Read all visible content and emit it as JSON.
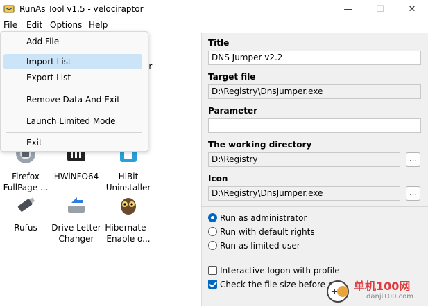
{
  "window": {
    "title": "RunAs Tool v1.5 - velociraptor",
    "minimize": "—",
    "maximize": "☐",
    "close": "✕"
  },
  "menubar": {
    "items": [
      "File",
      "Edit",
      "Options",
      "Help"
    ]
  },
  "file_menu": {
    "items": [
      "Add File",
      "Import List",
      "Export List",
      "Remove Data And Exit",
      "Launch Limited Mode",
      "Exit"
    ],
    "highlighted": "Import List"
  },
  "apps": {
    "partial_right_text": "er",
    "tiles": [
      {
        "label": "Firefox FullPage ...",
        "icon": "firefox-screenshot-icon"
      },
      {
        "label": "HWiNFO64",
        "icon": "hwinfo-icon"
      },
      {
        "label": "HiBit Uninstaller",
        "icon": "hibit-uninstaller-icon"
      },
      {
        "label": "Rufus",
        "icon": "usb-drive-icon"
      },
      {
        "label": "Drive Letter Changer",
        "icon": "drive-arrows-icon"
      },
      {
        "label": "Hibernate - Enable o...",
        "icon": "owl-icon"
      }
    ]
  },
  "details": {
    "title_label": "Title",
    "title_value": "DNS Jumper v2.2",
    "target_label": "Target file",
    "target_value": "D:\\Registry\\DnsJumper.exe",
    "param_label": "Parameter",
    "param_value": "",
    "workdir_label": "The working directory",
    "workdir_value": "D:\\Registry",
    "icon_label": "Icon",
    "icon_value": "D:\\Registry\\DnsJumper.exe",
    "browse_label": "..."
  },
  "run_mode": {
    "options": [
      "Run as administrator",
      "Run with default rights",
      "Run as limited user"
    ],
    "selected": "Run as administrator"
  },
  "checks": {
    "interactive": "Interactive logon with profile",
    "interactive_checked": false,
    "filesize": "Check the file size before run",
    "filesize_checked": true
  },
  "watermark": {
    "line1": "单机100网",
    "line2": "danji100.com"
  }
}
